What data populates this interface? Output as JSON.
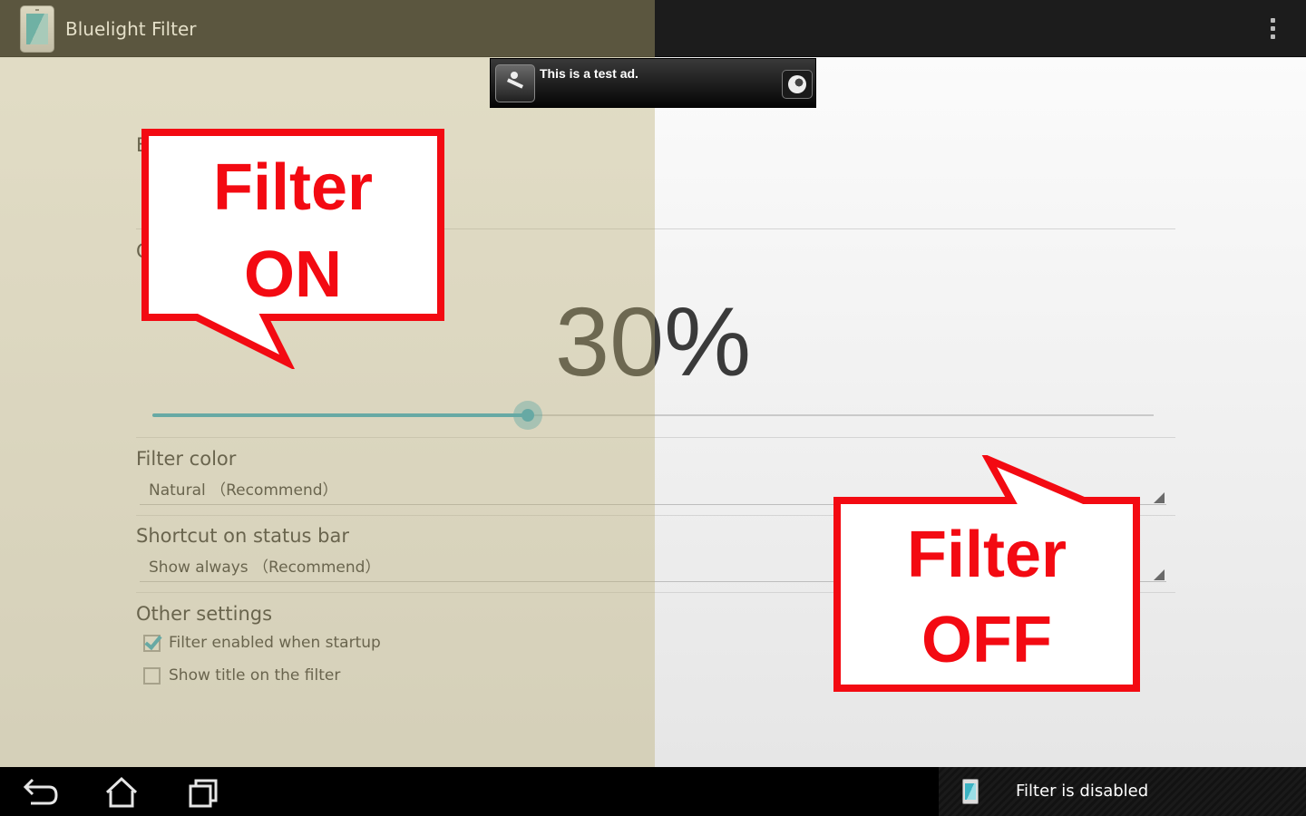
{
  "app": {
    "title": "Bluelight Filter",
    "icon": "phone-filter-icon"
  },
  "ad": {
    "text": "This is a test ad.",
    "icon": "running-person-icon",
    "globe_icon": "globe-icon"
  },
  "sections": {
    "enable_title_partial": "E",
    "opacity_title_partial": "C"
  },
  "opacity": {
    "value_text": "30%",
    "value": 30
  },
  "filter_color": {
    "title": "Filter color",
    "value": "Natural （Recommend）"
  },
  "shortcut": {
    "title": "Shortcut on status bar",
    "value": "Show always （Recommend）"
  },
  "other": {
    "title": "Other settings",
    "options": [
      {
        "label": "Filter enabled when startup",
        "checked": true
      },
      {
        "label": "Show title on the filter",
        "checked": false
      }
    ]
  },
  "callouts": {
    "on": {
      "line1": "Filter",
      "line2": "ON"
    },
    "off": {
      "line1": "Filter",
      "line2": "OFF"
    }
  },
  "notification": {
    "text": "Filter is disabled"
  },
  "colors": {
    "accent": "#2fa6c3",
    "callout_red": "#f30a12",
    "filter_tint": "#bcae76"
  }
}
